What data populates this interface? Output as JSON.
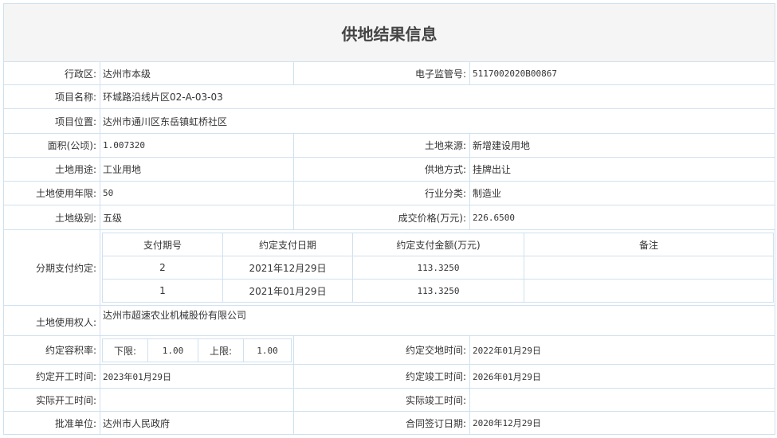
{
  "title": "供地结果信息",
  "rows": {
    "district_label": "行政区:",
    "district_value": "达州市本级",
    "e_code_label": "电子监管号:",
    "e_code_value": "5117002020B00867",
    "project_name_label": "项目名称:",
    "project_name_value": "环城路沿线片区02-A-03-03",
    "project_location_label": "项目位置:",
    "project_location_value": "达州市通川区东岳镇虹桥社区",
    "area_label": "面积(公顷):",
    "area_value": "1.007320",
    "land_source_label": "土地来源:",
    "land_source_value": "新增建设用地",
    "land_use_label": "土地用途:",
    "land_use_value": "工业用地",
    "supply_method_label": "供地方式:",
    "supply_method_value": "挂牌出让",
    "use_years_label": "土地使用年限:",
    "use_years_value": "50",
    "industry_label": "行业分类:",
    "industry_value": "制造业",
    "land_grade_label": "土地级别:",
    "land_grade_value": "五级",
    "price_label": "成交价格(万元):",
    "price_value": "226.6500",
    "installments_label": "分期支付约定:",
    "holder_label": "土地使用权人:",
    "holder_value": "达州市超速农业机械股份有限公司",
    "far_label": "约定容积率:",
    "far_lower_label": "下限:",
    "far_lower_value": "1.00",
    "far_upper_label": "上限:",
    "far_upper_value": "1.00",
    "handover_label": "约定交地时间:",
    "handover_value": "2022年01月29日",
    "start_label": "约定开工时间:",
    "start_value": "2023年01月29日",
    "complete_label": "约定竣工时间:",
    "complete_value": "2026年01月29日",
    "actual_start_label": "实际开工时间:",
    "actual_start_value": "",
    "actual_complete_label": "实际竣工时间:",
    "actual_complete_value": "",
    "approver_label": "批准单位:",
    "approver_value": "达州市人民政府",
    "contract_date_label": "合同签订日期:",
    "contract_date_value": "2020年12月29日"
  },
  "payments": {
    "headers": [
      "支付期号",
      "约定支付日期",
      "约定支付金额(万元)",
      "备注"
    ],
    "rows": [
      [
        "2",
        "2021年12月29日",
        "113.3250",
        ""
      ],
      [
        "1",
        "2021年01月29日",
        "113.3250",
        ""
      ]
    ]
  }
}
